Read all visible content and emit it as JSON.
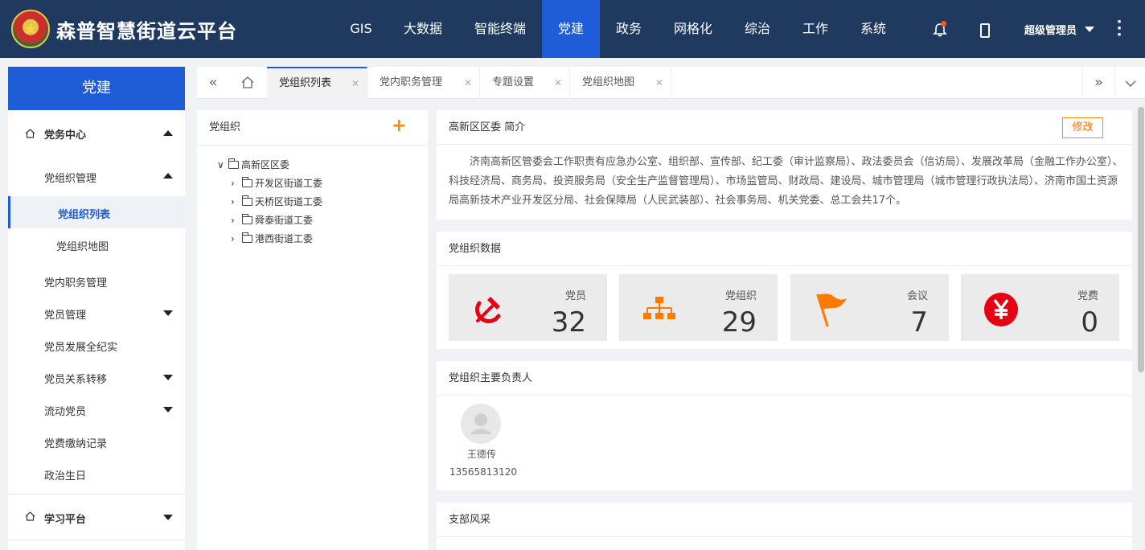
{
  "app": {
    "title": "森普智慧街道云平台"
  },
  "nav": {
    "items": [
      {
        "label": "GIS",
        "active": false
      },
      {
        "label": "大数据",
        "active": false
      },
      {
        "label": "智能终端",
        "active": false
      },
      {
        "label": "党建",
        "active": true
      },
      {
        "label": "政务",
        "active": false
      },
      {
        "label": "网格化",
        "active": false
      },
      {
        "label": "综治",
        "active": false
      },
      {
        "label": "工作",
        "active": false
      },
      {
        "label": "系统",
        "active": false
      }
    ],
    "user": "超级管理员"
  },
  "sidebar": {
    "title": "党建",
    "items": [
      {
        "label": "党务中心"
      },
      {
        "label": "党组织管理"
      },
      {
        "label": "党组织列表"
      },
      {
        "label": "党组织地图"
      },
      {
        "label": "党内职务管理"
      },
      {
        "label": "党员管理"
      },
      {
        "label": "党员发展全纪实"
      },
      {
        "label": "党员关系转移"
      },
      {
        "label": "流动党员"
      },
      {
        "label": "党费缴纳记录"
      },
      {
        "label": "政治生日"
      },
      {
        "label": "学习平台"
      }
    ]
  },
  "tabs": [
    {
      "label": "党组织列表",
      "active": true
    },
    {
      "label": "党内职务管理",
      "active": false
    },
    {
      "label": "专题设置",
      "active": false
    },
    {
      "label": "党组织地图",
      "active": false
    }
  ],
  "tree": {
    "title": "党组织",
    "root": "高新区区委",
    "children": [
      "开发区街道工委",
      "天桥区街道工委",
      "舜泰街道工委",
      "港西街道工委"
    ]
  },
  "intro": {
    "title": "高新区区委 简介",
    "edit_label": "修改",
    "text": "济南高新区管委会工作职责有应急办公室、组织部、宣传部、纪工委（审计监察局）、政法委员会（信访局）、发展改革局（金融工作办公室）、科技经济局、商务局、投资服务局（安全生产监督管理局）、市场监管局、财政局、建设局、城市管理局（城市管理行政执法局）、济南市国土资源局高新技术产业开发区分局、社会保障局（人民武装部）、社会事务局、机关党委、总工会共17个。"
  },
  "stats": {
    "title": "党组织数据",
    "items": [
      {
        "label": "党员",
        "value": "32",
        "icon": "hammer-sickle-icon",
        "color": "#e60012"
      },
      {
        "label": "党组织",
        "value": "29",
        "icon": "org-tree-icon",
        "color": "#ff7a00"
      },
      {
        "label": "会议",
        "value": "7",
        "icon": "flag-icon",
        "color": "#ff7a00"
      },
      {
        "label": "党费",
        "value": "0",
        "icon": "yuan-icon",
        "color": "#e60012"
      }
    ]
  },
  "leaders": {
    "title": "党组织主要负责人",
    "people": [
      {
        "name": "王德传",
        "phone": "13565813120"
      }
    ]
  },
  "branch": {
    "title": "支部风采"
  }
}
